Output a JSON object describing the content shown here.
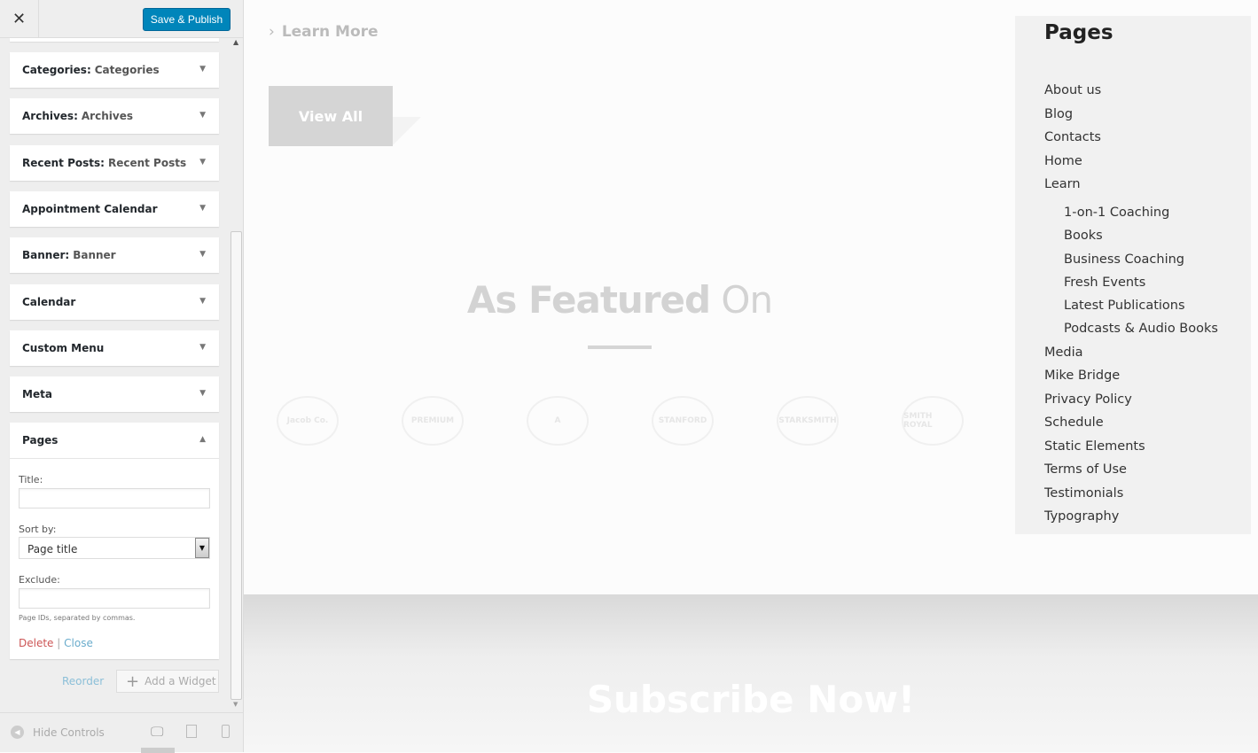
{
  "sidebar": {
    "save_label": "Save & Publish",
    "widgets": [
      {
        "name": "Categories",
        "sub": "Categories"
      },
      {
        "name": "Archives",
        "sub": "Archives"
      },
      {
        "name": "Recent Posts",
        "sub": "Recent Posts"
      },
      {
        "name": "Appointment Calendar",
        "sub": ""
      },
      {
        "name": "Banner",
        "sub": "Banner"
      },
      {
        "name": "Calendar",
        "sub": ""
      },
      {
        "name": "Custom Menu",
        "sub": ""
      },
      {
        "name": "Meta",
        "sub": ""
      },
      {
        "name": "Pages",
        "sub": ""
      }
    ],
    "pages_form": {
      "title_label": "Title:",
      "title_value": "",
      "sort_label": "Sort by:",
      "sort_value": "Page title",
      "exclude_label": "Exclude:",
      "exclude_value": "",
      "exclude_hint": "Page IDs, separated by commas.",
      "delete": "Delete",
      "sep": "|",
      "close": "Close"
    },
    "reorder": "Reorder",
    "add_widget": "Add a Widget",
    "hide_controls": "Hide Controls"
  },
  "preview": {
    "learn_more": "Learn More",
    "view_all": "View All",
    "featured_bold": "As Featured",
    "featured_light": "On",
    "logos": [
      "Jacob Co.",
      "PREMIUM",
      "A",
      "STANFORD",
      "STARKSMITH",
      "SMITH ROYAL"
    ],
    "pages_title": "Pages",
    "pages": [
      {
        "t": "About us"
      },
      {
        "t": "Blog"
      },
      {
        "t": "Contacts"
      },
      {
        "t": "Home"
      },
      {
        "t": "Learn"
      },
      {
        "t": "1-on-1 Coaching",
        "c": 1
      },
      {
        "t": "Books",
        "c": 1
      },
      {
        "t": "Business Coaching",
        "c": 1
      },
      {
        "t": "Fresh Events",
        "c": 1
      },
      {
        "t": "Latest Publications",
        "c": 1
      },
      {
        "t": "Podcasts & Audio Books",
        "c": 1
      },
      {
        "t": "Media"
      },
      {
        "t": "Mike Bridge"
      },
      {
        "t": "Privacy Policy"
      },
      {
        "t": "Schedule"
      },
      {
        "t": "Static Elements"
      },
      {
        "t": "Terms of Use"
      },
      {
        "t": "Testimonials"
      },
      {
        "t": "Typography"
      }
    ],
    "subscribe": "Subscribe Now!"
  }
}
